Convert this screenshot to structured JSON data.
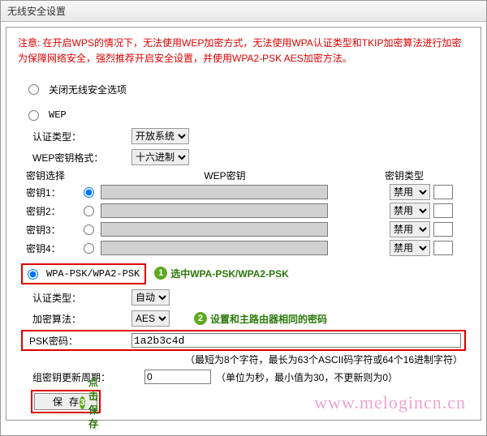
{
  "title": "无线安全设置",
  "note_line1": "注意: 在开启WPS的情况下，无法使用WEP加密方式，无法使用WPA认证类型和TKIP加密算法进行加密",
  "note_line2": "为保障网络安全，强烈推荐开启安全设置，并使用WPA2-PSK AES加密方法。",
  "opt_off": "关闭无线安全选项",
  "opt_wep": "WEP",
  "wep": {
    "auth_label": "认证类型：",
    "auth_value": "开放系统",
    "fmt_label": "WEP密钥格式：",
    "fmt_value": "十六进制",
    "key_select_label": "密钥选择",
    "key_col": "WEP密钥",
    "type_col": "密钥类型",
    "rows": [
      {
        "label": "密钥1：",
        "checked": true,
        "type": "禁用"
      },
      {
        "label": "密钥2：",
        "checked": false,
        "type": "禁用"
      },
      {
        "label": "密钥3：",
        "checked": false,
        "type": "禁用"
      },
      {
        "label": "密钥4：",
        "checked": false,
        "type": "禁用"
      }
    ]
  },
  "opt_wpa": "WPA-PSK/WPA2-PSK",
  "callout1": "选中WPA-PSK/WPA2-PSK",
  "wpa": {
    "auth_label": "认证类型：",
    "auth_value": "自动",
    "algo_label": "加密算法：",
    "algo_value": "AES",
    "psk_label": "PSK密码：",
    "psk_value": "1a2b3c4d",
    "psk_hint": "（最短为8个字符，最长为63个ASCII码字符或64个16进制字符）",
    "group_label": "组密钥更新周期：",
    "group_value": "0",
    "group_hint": "（单位为秒，最小值为30，不更新则为0）"
  },
  "callout2": "设置和主路由器相同的密码",
  "callout3": "点击保存",
  "save_btn": "保存",
  "watermark": "www.melogincn.cn"
}
